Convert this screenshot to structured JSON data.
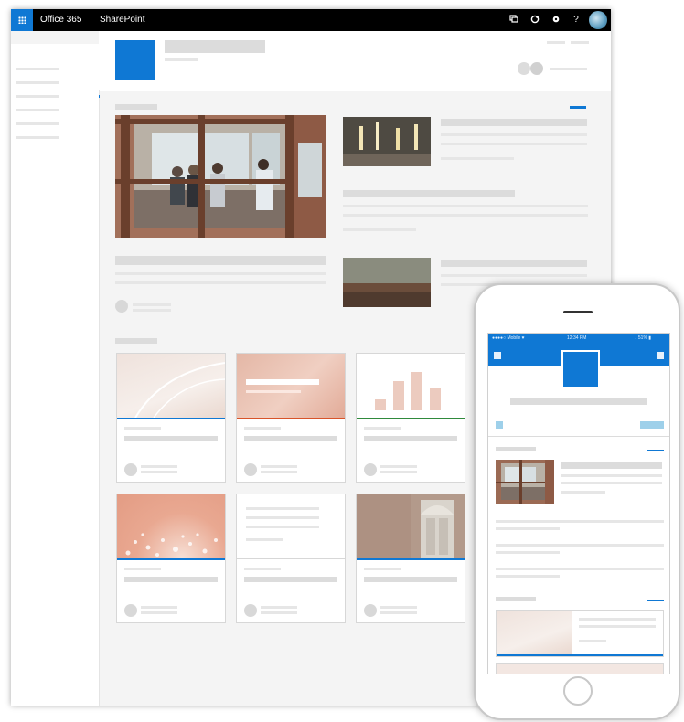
{
  "suite_bar": {
    "app_launcher": "app-launcher",
    "brand": "Office 365",
    "app_name": "SharePoint",
    "icons": [
      "chat-icon",
      "skype-icon",
      "settings-icon",
      "help-icon"
    ],
    "help_glyph": "?"
  },
  "colors": {
    "accent": "#0f78d4",
    "card_orange": "#d8542a",
    "card_green": "#2f8a3c",
    "suite_bar": "#000000"
  },
  "phone": {
    "status_carrier": "●●●●○ Mobile ♥",
    "status_time": "12:34 PM",
    "status_battery": "↓ 51% ▮"
  }
}
